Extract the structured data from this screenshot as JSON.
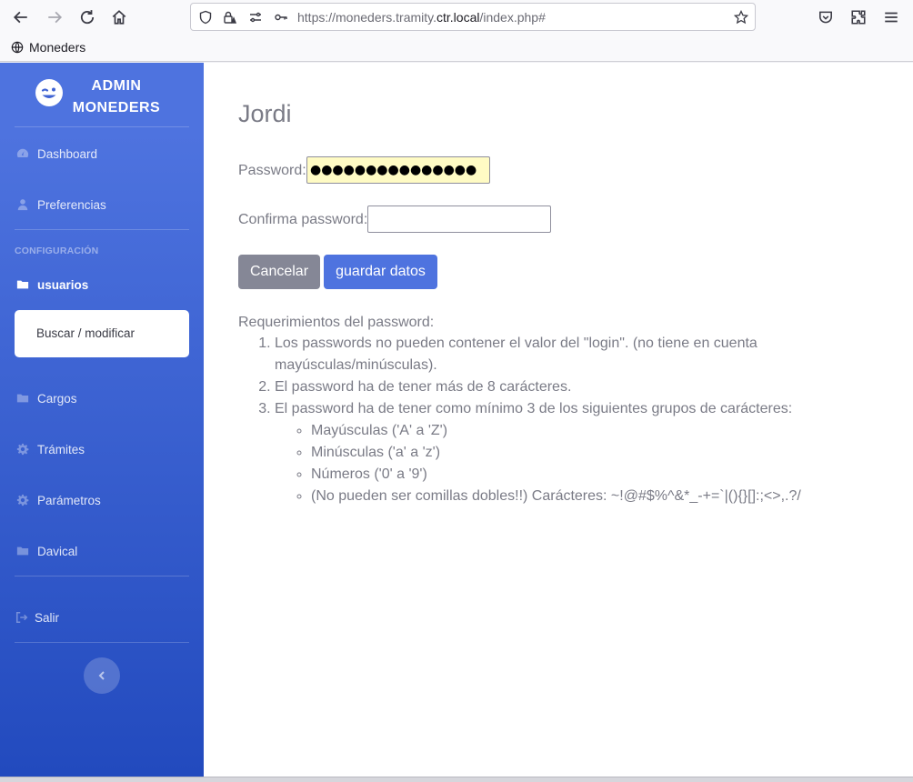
{
  "browser": {
    "url_prefix": "https://moneders.tramity.",
    "url_domain": "ctr.local",
    "url_suffix": "/index.php#",
    "bookmark": "Moneders"
  },
  "sidebar": {
    "brand_line1": "ADMIN",
    "brand_line2": "MONEDERS",
    "dashboard": "Dashboard",
    "preferencias": "Preferencias",
    "section_config": "CONFIGURACIÓN",
    "usuarios": "usuarios",
    "submenu_buscar": "Buscar / modificar",
    "cargos": "Cargos",
    "tramites": "Trámites",
    "parametros": "Parámetros",
    "davical": "Davical",
    "salir": "Salir"
  },
  "main": {
    "title": "Jordi",
    "password_label": "Password:",
    "password_value": "●●●●●●●●●●●●●●●",
    "confirm_label": "Confirma password:",
    "confirm_value": "",
    "cancel_label": "Cancelar",
    "save_label": "guardar datos",
    "req_title": "Requerimientos del password:",
    "req_1": "Los passwords no pueden contener el valor del \"login\". (no tiene en cuenta mayúsculas/minúsculas).",
    "req_2": "El password ha de tener más de 8 carácteres.",
    "req_3": "El password ha de tener como mínimo 3 de los siguientes grupos de carácteres:",
    "req_3a": "Mayúsculas ('A' a 'Z')",
    "req_3b": "Minúsculas ('a' a 'z')",
    "req_3c": "Números ('0' a '9')",
    "req_3d": "(No pueden ser comillas dobles!!) Carácteres: ~!@#$%^&*_-+=`|(){}[]:;<>,.?/"
  }
}
